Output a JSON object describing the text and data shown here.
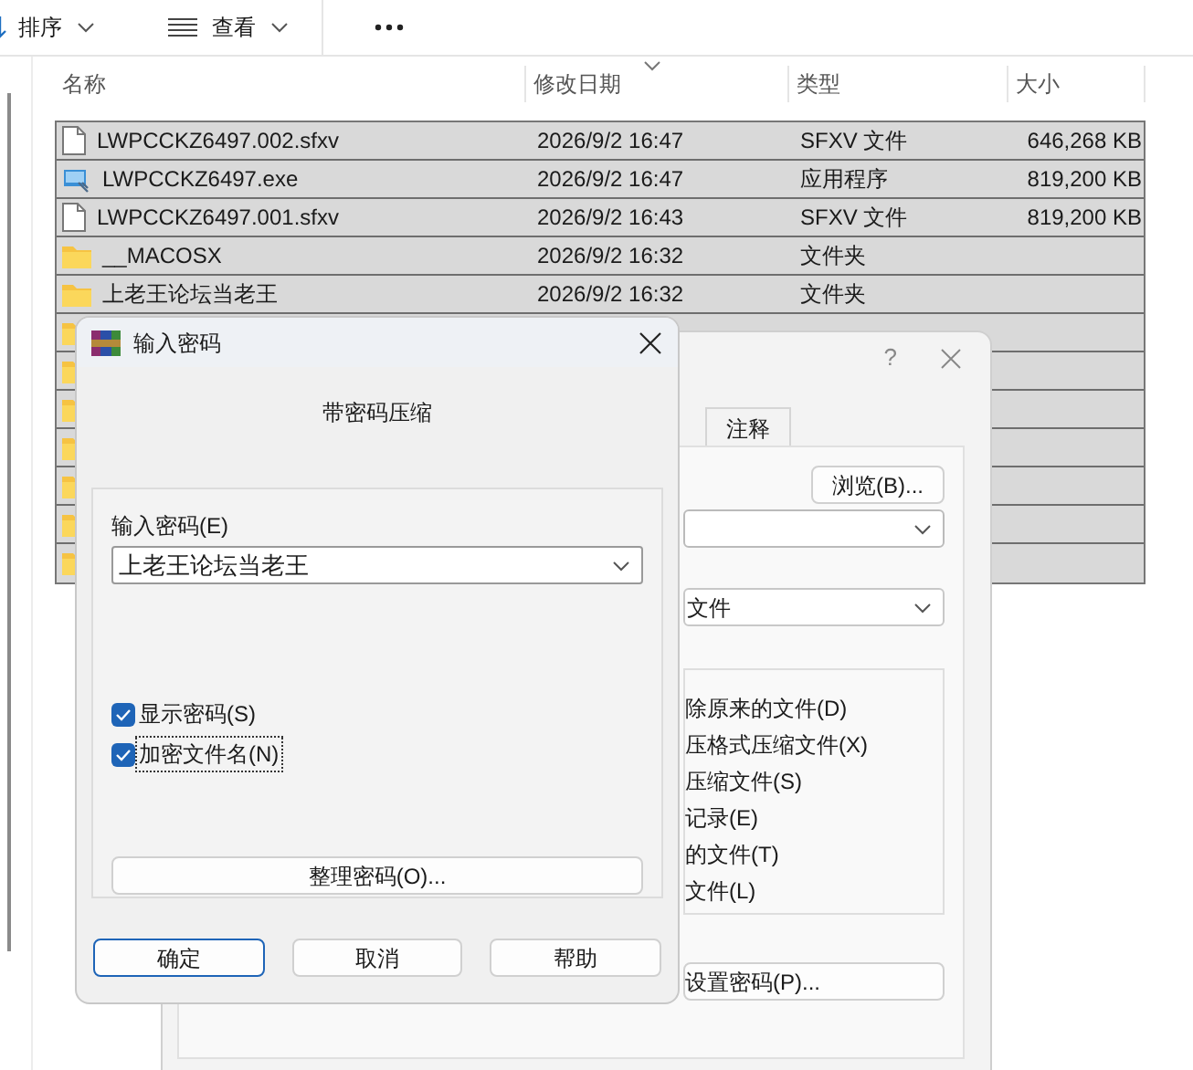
{
  "toolbar": {
    "items": [
      {
        "kind": "sort",
        "label": "排序"
      },
      {
        "kind": "view",
        "label": "查看"
      },
      {
        "kind": "more"
      }
    ]
  },
  "file_list": {
    "columns": [
      "名称",
      "修改日期",
      "类型",
      "大小"
    ],
    "rows": [
      {
        "kind": "file",
        "name": "LWPCCKZ6497.002.sfxv",
        "modified": "2026/9/2 16:47",
        "type": "SFXV 文件",
        "size": "646,268 KB",
        "selected": true
      },
      {
        "kind": "exe",
        "name": "LWPCCKZ6497.exe",
        "modified": "2026/9/2 16:47",
        "type": "应用程序",
        "size": "819,200 KB",
        "selected": true
      },
      {
        "kind": "file",
        "name": "LWPCCKZ6497.001.sfxv",
        "modified": "2026/9/2 16:43",
        "type": "SFXV 文件",
        "size": "819,200 KB",
        "selected": true
      },
      {
        "kind": "folder",
        "name": "__MACOSX",
        "modified": "2026/9/2 16:32",
        "type": "文件夹",
        "selected": true
      },
      {
        "kind": "folder",
        "name": "上老王论坛当老王",
        "modified": "2026/9/2 16:32",
        "type": "文件夹",
        "selected": true
      },
      {
        "kind": "folder",
        "selected": true
      },
      {
        "kind": "folder",
        "selected": true
      },
      {
        "kind": "folder",
        "selected": true
      },
      {
        "kind": "folder",
        "selected": true
      },
      {
        "kind": "folder",
        "selected": true
      },
      {
        "kind": "folder",
        "selected": true
      },
      {
        "kind": "folder",
        "selected": true
      }
    ]
  },
  "archive_dialog": {
    "help_glyph": "?",
    "tabs": [
      {
        "label": "注释",
        "selected": false
      }
    ],
    "browse_button": "浏览(B)...",
    "update_mode": "文件",
    "options": [
      "除原来的文件(D)",
      "压格式压缩文件(X)",
      "压缩文件(S)",
      "记录(E)",
      "的文件(T)",
      "文件(L)"
    ],
    "set_password_button": "设置密码(P)..."
  },
  "password_dialog": {
    "title": "输入密码",
    "heading": "带密码压缩",
    "password_label": "输入密码(E)",
    "password": "上老王论坛当老王",
    "checkboxes": [
      {
        "label": "显示密码(S)",
        "checked": true,
        "focused": false
      },
      {
        "label": "加密文件名(N)",
        "checked": true,
        "focused": true
      }
    ],
    "organize_button": "整理密码(O)...",
    "buttons": [
      {
        "label": "确定",
        "default": true
      },
      {
        "label": "取消",
        "default": false
      },
      {
        "label": "帮助",
        "default": false
      }
    ]
  }
}
